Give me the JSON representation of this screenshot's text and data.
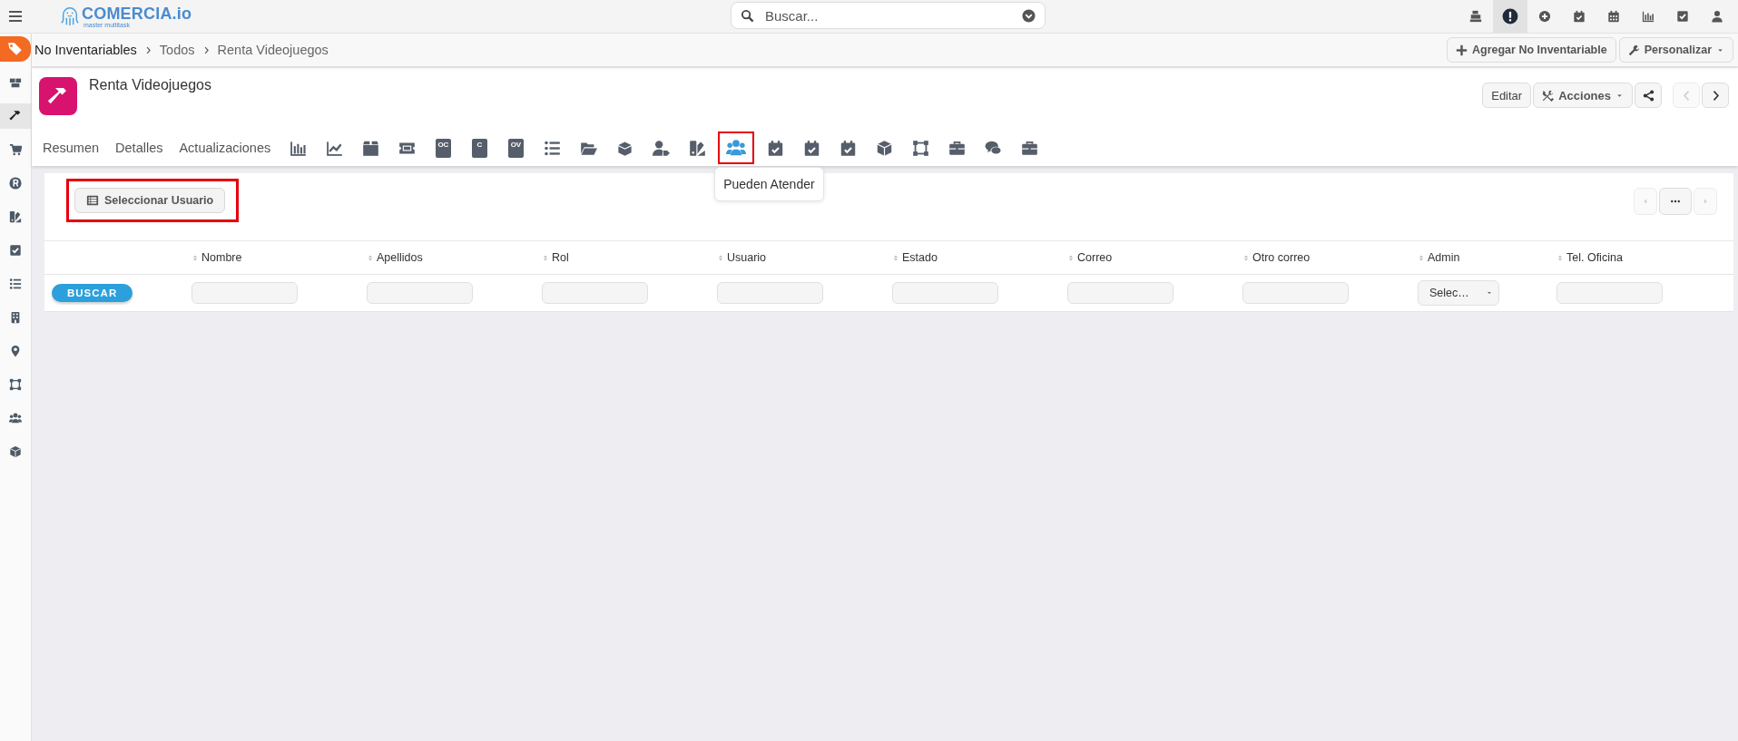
{
  "topbar": {
    "logo": {
      "name": "COMERCIA.io",
      "tagline": "master multitask"
    },
    "search": {
      "placeholder": "Buscar..."
    },
    "actions": [
      {
        "selected": false
      },
      {
        "selected": true
      },
      {
        "selected": false
      },
      {
        "selected": false
      },
      {
        "selected": false
      },
      {
        "selected": false
      },
      {
        "selected": false
      },
      {
        "selected": false
      }
    ]
  },
  "sidebar": {
    "items": [
      {
        "kind": "module",
        "selected": false
      },
      {
        "kind": "link",
        "selected": false
      },
      {
        "kind": "link",
        "selected": true
      },
      {
        "kind": "link",
        "selected": false
      },
      {
        "kind": "link",
        "selected": false
      },
      {
        "kind": "link",
        "selected": false
      },
      {
        "kind": "link",
        "selected": false
      },
      {
        "kind": "link",
        "selected": false
      },
      {
        "kind": "link",
        "selected": false
      },
      {
        "kind": "link",
        "selected": false
      },
      {
        "kind": "link",
        "selected": false
      },
      {
        "kind": "link",
        "selected": false
      },
      {
        "kind": "link",
        "selected": false
      }
    ]
  },
  "breadcrumb": [
    "No Inventariables",
    "Todos",
    "Renta Videojuegos"
  ],
  "breadcrumb_actions": [
    {
      "kind": "add",
      "label": "Agregar No Inventariable"
    },
    {
      "kind": "dropdown",
      "label": "Personalizar"
    }
  ],
  "record": {
    "title": "Renta Videojuegos",
    "buttons": [
      {
        "kind": "text",
        "label": "Editar"
      },
      {
        "kind": "dropdown",
        "label": "Acciones"
      },
      {
        "kind": "share"
      }
    ],
    "pager": [
      {
        "disabled": true
      },
      {
        "disabled": false
      }
    ]
  },
  "tabs": [
    {
      "kind": "text",
      "label": "Resumen",
      "selected": false
    },
    {
      "kind": "text",
      "label": "Detalles",
      "selected": false
    },
    {
      "kind": "text",
      "label": "Actualizaciones",
      "selected": false
    },
    {
      "kind": "icon",
      "selected": false
    },
    {
      "kind": "icon",
      "selected": false
    },
    {
      "kind": "icon",
      "selected": false
    },
    {
      "kind": "icon",
      "selected": false
    },
    {
      "kind": "doc",
      "label": "OC",
      "selected": false
    },
    {
      "kind": "doc",
      "label": "C",
      "selected": false
    },
    {
      "kind": "doc",
      "label": "OV",
      "selected": false
    },
    {
      "kind": "icon",
      "selected": false
    },
    {
      "kind": "icon",
      "selected": false
    },
    {
      "kind": "icon",
      "selected": false
    },
    {
      "kind": "icon",
      "selected": false
    },
    {
      "kind": "icon",
      "selected": false
    },
    {
      "kind": "icon",
      "selected": true,
      "highlighted": true,
      "tooltip": "Pueden Atender"
    },
    {
      "kind": "icon",
      "selected": false
    },
    {
      "kind": "icon",
      "selected": false
    },
    {
      "kind": "icon",
      "selected": false
    },
    {
      "kind": "icon",
      "selected": false
    },
    {
      "kind": "icon",
      "selected": false
    },
    {
      "kind": "icon",
      "selected": false
    },
    {
      "kind": "icon",
      "selected": false
    },
    {
      "kind": "icon",
      "selected": false
    }
  ],
  "panel": {
    "select_button": {
      "label": "Seleccionar Usuario",
      "highlighted": true
    },
    "pager": [
      {
        "kind": "prev",
        "disabled": true
      },
      {
        "kind": "more",
        "disabled": false
      },
      {
        "kind": "next",
        "disabled": true
      }
    ],
    "table": {
      "columns": [
        "Nombre",
        "Apellidos",
        "Rol",
        "Usuario",
        "Estado",
        "Correo",
        "Otro correo",
        "Admin",
        "Tel. Oficina"
      ],
      "search_button": "BUSCAR",
      "filters": [
        {
          "kind": "text"
        },
        {
          "kind": "text"
        },
        {
          "kind": "text"
        },
        {
          "kind": "text"
        },
        {
          "kind": "text"
        },
        {
          "kind": "text"
        },
        {
          "kind": "text"
        },
        {
          "kind": "select",
          "value": "Selec…"
        },
        {
          "kind": "text"
        }
      ]
    }
  }
}
